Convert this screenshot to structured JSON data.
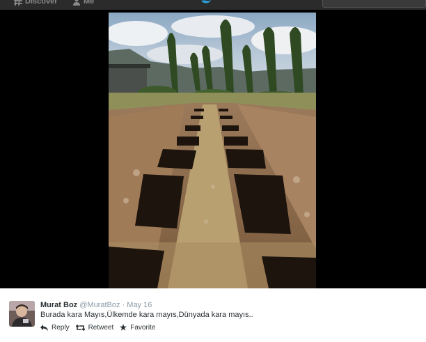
{
  "topbar": {
    "discover_label": "Discover",
    "me_label": "Me",
    "discover_icon": "hashtag-icon",
    "me_icon": "person-icon",
    "logo_icon": "twitter-bird-icon",
    "search_placeholder": ""
  },
  "media": {
    "description_icon": "photo"
  },
  "tweet": {
    "name": "Murat Boz",
    "handle": "@MuratBoz",
    "date_separator": "·",
    "date": "May 16",
    "text": "Burada kara Mayıs,Ülkemde kara mayıs,Dünyada kara mayıs..",
    "actions": {
      "reply_label": "Reply",
      "retweet_label": "Retweet",
      "favorite_label": "Favorite"
    }
  },
  "colors": {
    "topbar_bg": "#2b2b2b",
    "stage_bg": "#000000",
    "name": "#292f33",
    "meta": "#8899a6"
  }
}
